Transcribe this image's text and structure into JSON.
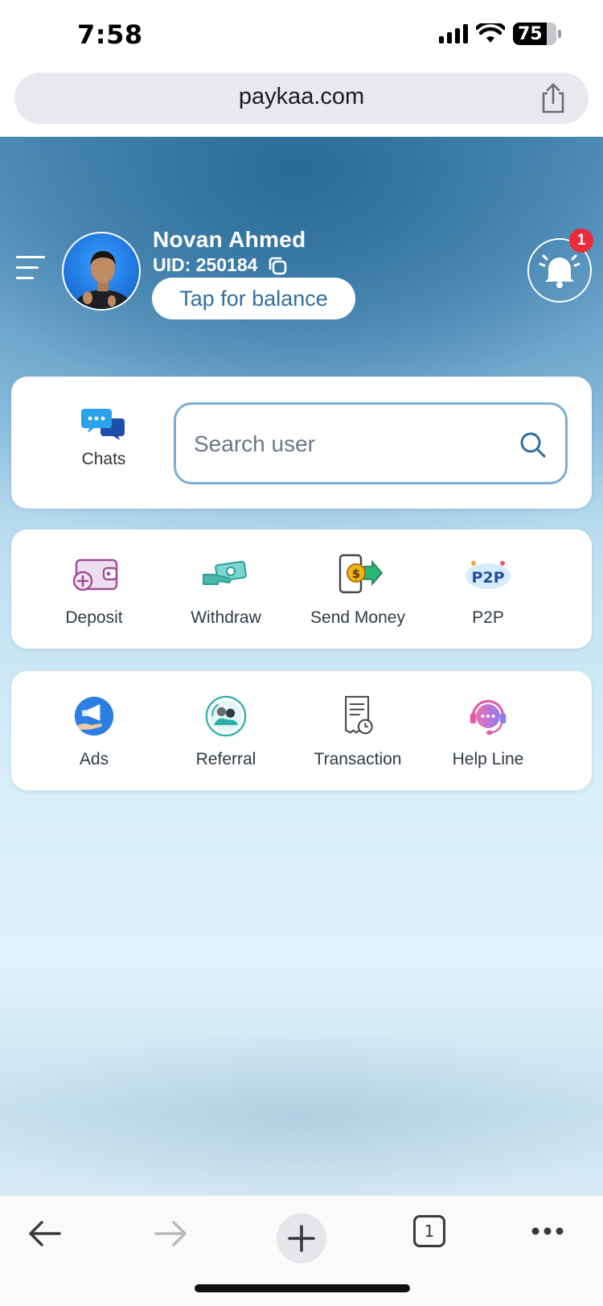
{
  "status_bar": {
    "time": "7:58",
    "battery": "75"
  },
  "browser": {
    "url": "paykaa.com"
  },
  "profile": {
    "name": "Novan Ahmed",
    "uid": "UID: 250184",
    "balance_button": "Tap for balance",
    "notification_count": "1"
  },
  "search": {
    "chats_label": "Chats",
    "placeholder": "Search user"
  },
  "actions_row_1": [
    {
      "label": "Deposit",
      "icon": "wallet-plus-icon"
    },
    {
      "label": "Withdraw",
      "icon": "cash-hand-icon"
    },
    {
      "label": "Send Money",
      "icon": "phone-dollar-icon"
    },
    {
      "label": "P2P",
      "icon": "p2p-icon"
    }
  ],
  "actions_row_2": [
    {
      "label": "Ads",
      "icon": "megaphone-icon"
    },
    {
      "label": "Referral",
      "icon": "referral-icon"
    },
    {
      "label": "Transaction",
      "icon": "receipt-clock-icon"
    },
    {
      "label": "Help Line",
      "icon": "headset-icon"
    }
  ],
  "toolbar": {
    "tab_count": "1"
  }
}
